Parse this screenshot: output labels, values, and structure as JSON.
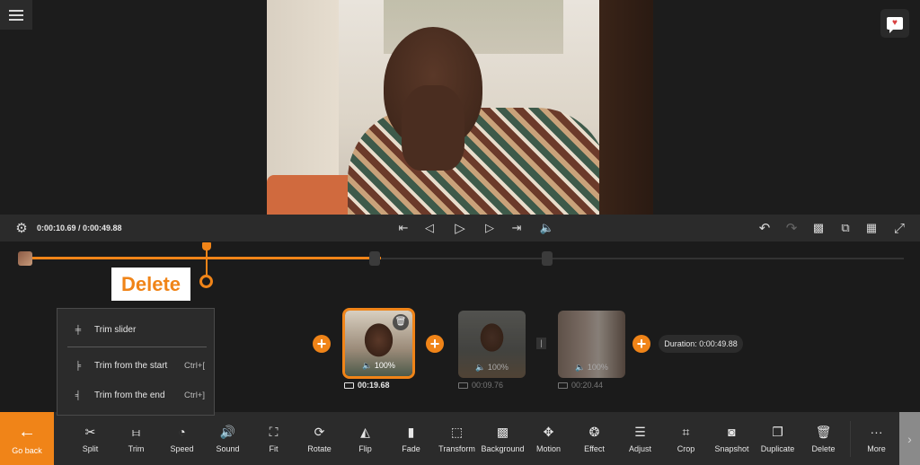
{
  "header": {
    "menu_icon": "hamburger-icon",
    "feedback_icon": "feedback-heart-icon"
  },
  "transport": {
    "settings_icon": "settings-icon",
    "timecode": "0:00:10.69 / 0:00:49.88",
    "buttons": [
      {
        "name": "skip-to-start",
        "icon": "⏮"
      },
      {
        "name": "previous-frame",
        "icon": "◁|"
      },
      {
        "name": "play",
        "icon": "▷"
      },
      {
        "name": "next-frame",
        "icon": "|▷"
      },
      {
        "name": "skip-to-end",
        "icon": "⏭"
      },
      {
        "name": "volume",
        "icon": "🔊"
      }
    ],
    "right_buttons": [
      {
        "name": "undo",
        "icon": "↶"
      },
      {
        "name": "redo",
        "icon": "↷"
      },
      {
        "name": "background-pattern",
        "icon": "▦"
      },
      {
        "name": "aspect-ratio",
        "icon": "⧉"
      },
      {
        "name": "grid",
        "icon": "▦"
      },
      {
        "name": "fullscreen",
        "icon": "⤢"
      }
    ]
  },
  "scrub": {
    "progress": 0.214,
    "delete_label": "Delete"
  },
  "context_menu": {
    "items": [
      {
        "label": "Trim slider",
        "icon": "trim-slider-icon",
        "shortcut": ""
      },
      {
        "label": "Trim from the start",
        "icon": "trim-start-icon",
        "shortcut": "Ctrl+["
      },
      {
        "label": "Trim from the end",
        "icon": "trim-end-icon",
        "shortcut": "Ctrl+]"
      }
    ]
  },
  "clips": [
    {
      "volume": "100%",
      "duration": "00:19.68",
      "selected": true
    },
    {
      "volume": "100%",
      "duration": "00:09.76",
      "selected": false
    },
    {
      "volume": "100%",
      "duration": "00:20.44",
      "selected": false
    }
  ],
  "total_duration": "Duration: 0:00:49.88",
  "toolbar": {
    "go_back": "Go back",
    "tools": [
      {
        "label": "Split",
        "icon": "✂"
      },
      {
        "label": "Trim",
        "icon": "⧦"
      },
      {
        "label": "Speed",
        "icon": "◔"
      },
      {
        "label": "Sound",
        "icon": "🔊"
      },
      {
        "label": "Fit",
        "icon": "⛶"
      },
      {
        "label": "Rotate",
        "icon": "⟳"
      },
      {
        "label": "Flip",
        "icon": "◭"
      },
      {
        "label": "Fade",
        "icon": "▮"
      },
      {
        "label": "Transform",
        "icon": "⬚"
      },
      {
        "label": "Background",
        "icon": "▩"
      },
      {
        "label": "Motion",
        "icon": "✥"
      },
      {
        "label": "Effect",
        "icon": "❂"
      },
      {
        "label": "Adjust",
        "icon": "☰"
      },
      {
        "label": "Crop",
        "icon": "⌗"
      },
      {
        "label": "Snapshot",
        "icon": "◙"
      },
      {
        "label": "Duplicate",
        "icon": "❐"
      },
      {
        "label": "Delete",
        "icon": "🗑"
      },
      {
        "label": "More",
        "icon": "···"
      }
    ],
    "next_icon": "›"
  },
  "colors": {
    "accent": "#f08418",
    "background": "#1b1b1b",
    "toolbar": "#2b2b2b"
  }
}
